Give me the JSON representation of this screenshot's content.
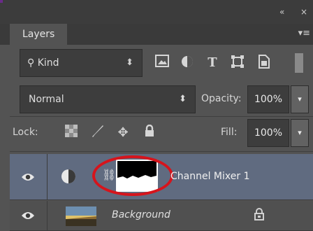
{
  "window": {
    "collapse_glyph": "«",
    "close_glyph": "×"
  },
  "panel": {
    "tab_label": "Layers",
    "menu_glyph": "▾≡"
  },
  "filter": {
    "kind_label": "Kind",
    "kind_arrows": "⬍",
    "icons": [
      "image-filter-icon",
      "adjustment-filter-icon",
      "type-filter-icon",
      "shape-filter-icon",
      "smart-object-filter-icon"
    ]
  },
  "blend": {
    "mode": "Normal",
    "arrows": "⬍",
    "opacity_label": "Opacity:",
    "opacity_value": "100%",
    "dropdown_glyph": "▾"
  },
  "lock": {
    "label": "Lock:",
    "fill_label": "Fill:",
    "fill_value": "100%",
    "dropdown_glyph": "▾"
  },
  "layers": [
    {
      "name": "Channel Mixer 1",
      "selected": true,
      "visible": true
    },
    {
      "name": "Background",
      "selected": false,
      "visible": true,
      "locked": true
    }
  ],
  "colors": {
    "highlight": "#d6141c",
    "selected_row": "#606b80"
  }
}
